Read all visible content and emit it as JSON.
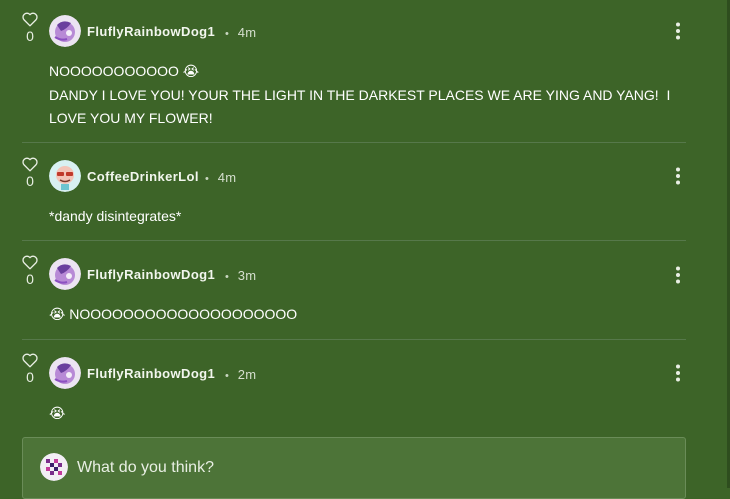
{
  "comments": [
    {
      "username": "FluflyRainbowDog1",
      "separator": "•",
      "time": "4m",
      "likes": "0",
      "body": "NOOOOOOOOOOO 😭\nDANDY I LOVE YOU! YOUR THE LIGHT IN THE DARKEST PLACES WE ARE YING AND YANG!  I LOVE YOU MY FLOWER!",
      "avatar": "unicorn-avatar"
    },
    {
      "username": "CoffeeDrinkerLol",
      "separator": "•",
      "time": "4m",
      "likes": "0",
      "body": "*dandy disintegrates*",
      "avatar": "coffee-cup-avatar"
    },
    {
      "username": "FluflyRainbowDog1",
      "separator": "•",
      "time": "3m",
      "likes": "0",
      "body": "😭 NOOOOOOOOOOOOOOOOOOOO",
      "avatar": "unicorn-avatar"
    },
    {
      "username": "FluflyRainbowDog1",
      "separator": "•",
      "time": "2m",
      "likes": "0",
      "body": "😭",
      "avatar": "unicorn-avatar"
    }
  ],
  "composer": {
    "placeholder": "What do you think?",
    "avatar": "pixel-avatar"
  },
  "colors": {
    "background": "#3d6428",
    "composer_bg": "#4d7438",
    "divider": "#56784a"
  },
  "icons": {
    "like": "heart-icon",
    "more": "more-vertical-icon"
  }
}
